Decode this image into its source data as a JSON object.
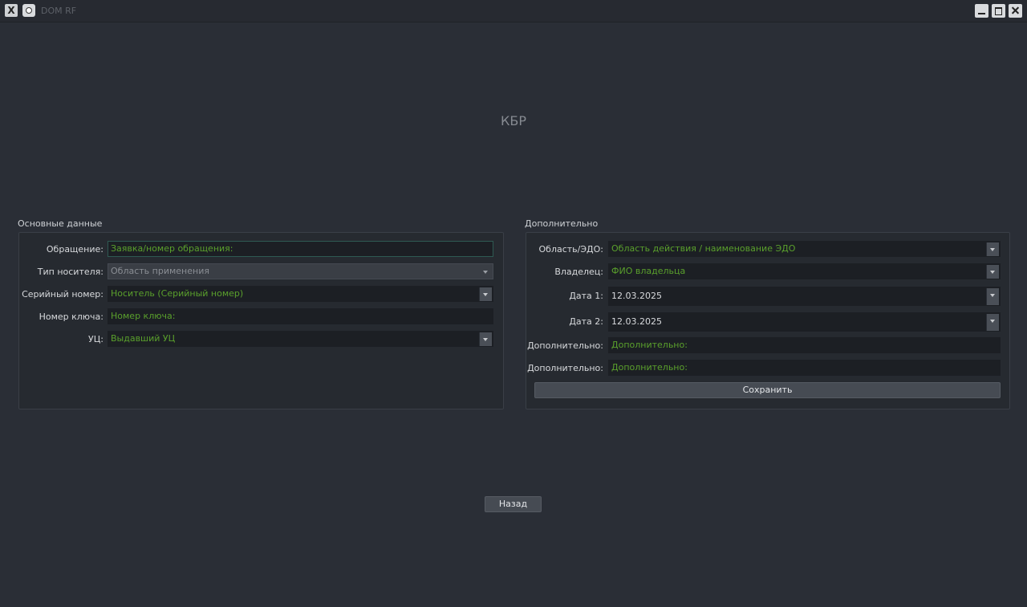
{
  "window": {
    "title": "DOM RF"
  },
  "heading": "КБР",
  "main_group": {
    "title": "Основные данные",
    "fields": [
      {
        "label": "Обращение:",
        "value": "Заявка/номер обращения:"
      },
      {
        "label": "Тип носителя:",
        "value": "Область применения"
      },
      {
        "label": "Серийный номер:",
        "value": "Носитель (Серийный номер)"
      },
      {
        "label": "Номер ключа:",
        "value": "Номер ключа:"
      },
      {
        "label": "УЦ:",
        "value": "Выдавший УЦ"
      }
    ]
  },
  "extra_group": {
    "title": "Дополнительно",
    "fields": [
      {
        "label": "Область/ЭДО:",
        "value": "Область действия / наименование ЭДО"
      },
      {
        "label": "Владелец:",
        "value": "ФИО владельца"
      },
      {
        "label": "Дата 1:",
        "value": "12.03.2025"
      },
      {
        "label": "Дата 2:",
        "value": "12.03.2025"
      },
      {
        "label": "Дополнительно:",
        "value": "Дополнительно:"
      },
      {
        "label": "Дополнительно:",
        "value": "Дополнительно:"
      }
    ],
    "save_label": "Сохранить"
  },
  "back_label": "Назад",
  "colors": {
    "background": "#2a2e36",
    "placeholder_green": "#5aa02c",
    "button": "#464b53"
  },
  "icons": [
    "app-x-icon",
    "app-settings-icon",
    "minimize-icon",
    "maximize-icon",
    "close-icon",
    "chevron-down-icon"
  ]
}
